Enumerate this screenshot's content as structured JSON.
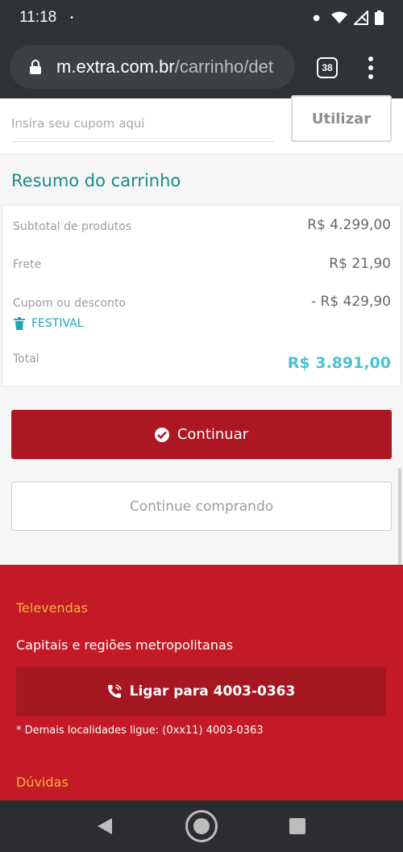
{
  "status_bar": {
    "time": "11:18",
    "dot": "•",
    "icons": [
      "notification-dot-icon",
      "wifi-icon",
      "signal-icon",
      "battery-icon"
    ]
  },
  "browser": {
    "url_domain": "m.extra.com.br",
    "url_path": "/carrinho/det",
    "tab_count": "38"
  },
  "coupon": {
    "placeholder": "Insira seu cupom aqui",
    "button_label": "Utilizar"
  },
  "summary": {
    "title": "Resumo do carrinho",
    "rows": [
      {
        "label": "Subtotal de produtos",
        "value": "R$ 4.299,00"
      },
      {
        "label": "Frete",
        "value": "R$ 21,90"
      },
      {
        "label": "Cupom ou desconto",
        "value": "- R$ 429,90"
      }
    ],
    "coupon_code": "FESTIVAL",
    "total_label": "Total",
    "total_value": "R$ 3.891,00"
  },
  "actions": {
    "continue_label": "Continuar",
    "keep_shopping_label": "Continue comprando"
  },
  "footer": {
    "televendas_title": "Televendas",
    "capitais_text": "Capitais e regiões metropolitanas",
    "call_label": "Ligar para 4003-0363",
    "demais_text": "* Demais localidades ligue: (0xx11) 4003-0363",
    "duvidas_title": "Dúvidas"
  },
  "colors": {
    "brand_red": "#c31a26",
    "button_red": "#ab1722",
    "teal": "#1a8a8a",
    "total_blue": "#4ac3d1",
    "footer_accent": "#f6b33c"
  }
}
